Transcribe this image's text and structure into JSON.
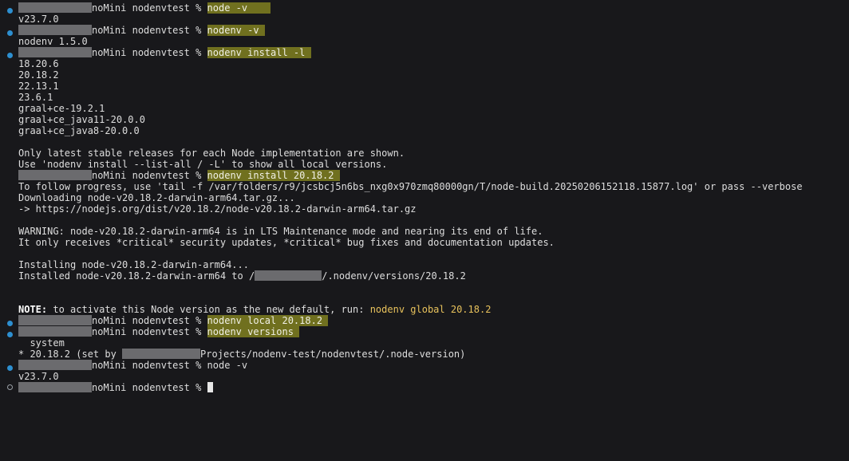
{
  "prompt": {
    "host_suffix": "noMini",
    "dir": "nodenvtest",
    "symbol": "%"
  },
  "lines": {
    "c1": "node -v",
    "o1": "v23.7.0",
    "c2": "nodenv -v",
    "o2": "nodenv 1.5.0",
    "c3": "nodenv install -l",
    "o3_1": "18.20.6",
    "o3_2": "20.18.2",
    "o3_3": "22.13.1",
    "o3_4": "23.6.1",
    "o3_5": "graal+ce-19.2.1",
    "o3_6": "graal+ce_java11-20.0.0",
    "o3_7": "graal+ce_java8-20.0.0",
    "o3_8": "Only latest stable releases for each Node implementation are shown.",
    "o3_9": "Use 'nodenv install --list-all / -L' to show all local versions.",
    "c4": "nodenv install 20.18.2",
    "o4_1": "To follow progress, use 'tail -f /var/folders/r9/jcsbcj5n6bs_nxg0x970zmq80000gn/T/node-build.20250206152118.15877.log' or pass --verbose",
    "o4_2": "Downloading node-v20.18.2-darwin-arm64.tar.gz...",
    "o4_3": "-> https://nodejs.org/dist/v20.18.2/node-v20.18.2-darwin-arm64.tar.gz",
    "o4_4": "WARNING: node-v20.18.2-darwin-arm64 is in LTS Maintenance mode and nearing its end of life.",
    "o4_5": "It only receives *critical* security updates, *critical* bug fixes and documentation updates.",
    "o4_6": "Installing node-v20.18.2-darwin-arm64...",
    "o4_7_a": "Installed node-v20.18.2-darwin-arm64 to /",
    "o4_7_b": "/.nodenv/versions/20.18.2",
    "note_label": "NOTE:",
    "note_text": " to activate this Node version as the new default, run: ",
    "note_cmd": "nodenv global 20.18.2",
    "c5": "nodenv local 20.18.2",
    "c6": "nodenv versions",
    "o6_1": "  system",
    "o6_2_a": "* 20.18.2 (set by ",
    "o6_2_b": "Projects/nodenv-test/nodenvtest/.node-version)",
    "c7": "node -v",
    "o7": "v23.7.0"
  },
  "colors": {
    "background": "#18181b",
    "highlight": "#70701f",
    "dot": "#2d8fd0",
    "note_cmd": "#e8c25c"
  }
}
